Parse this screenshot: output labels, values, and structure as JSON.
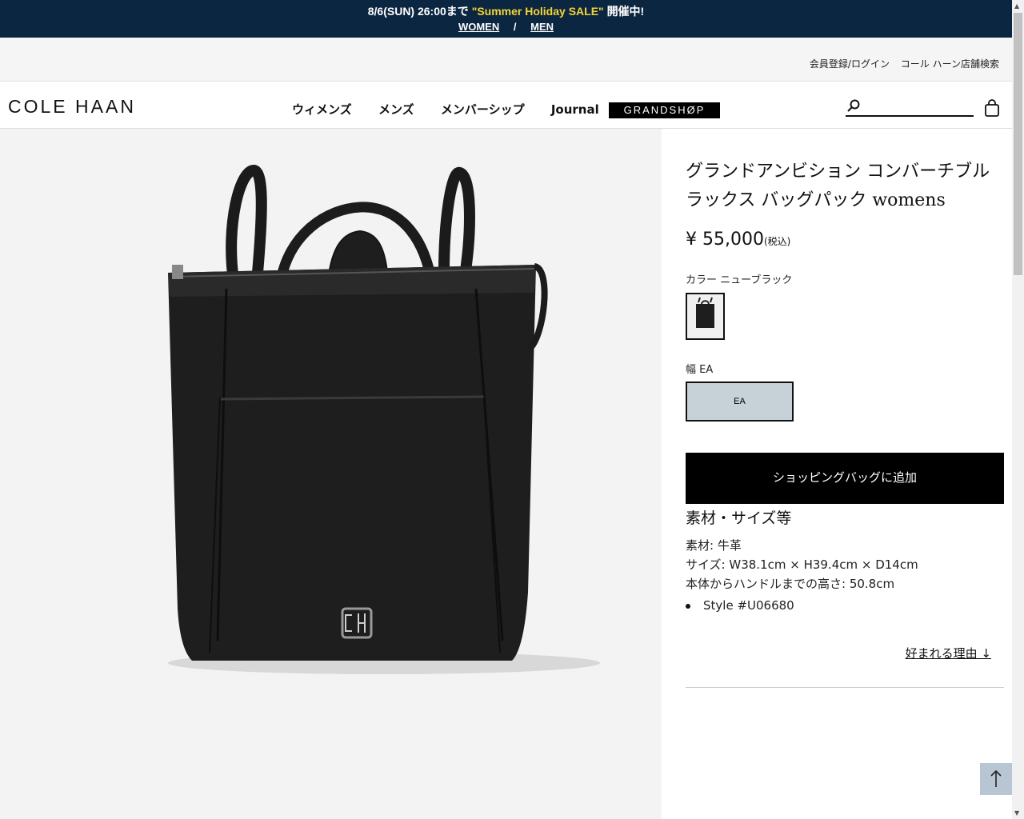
{
  "promo": {
    "line1_prefix": "8/6(SUN) 26:00まで",
    "sale_text": "\"Summer Holiday SALE\"",
    "line1_suffix": "開催中!",
    "women_link": "WOMEN",
    "separator": "/",
    "men_link": "MEN",
    "colors": {
      "background": "#0b2641",
      "sale": "#f4d534"
    }
  },
  "utility": {
    "login": "会員登録/ログイン",
    "store_search": "コール ハーン店舗検索"
  },
  "header": {
    "logo": "COLE HAAN",
    "nav": [
      "ウィメンズ",
      "メンズ",
      "メンバーシップ",
      "Journal"
    ],
    "grandshop": "GRANDSHØP",
    "search_placeholder": "",
    "icons": [
      "search-icon",
      "bag-icon"
    ]
  },
  "product": {
    "title": "グランドアンビション コンバーチブル ラックス バッグパック womens",
    "price": "¥ 55,000",
    "tax_note": "(税込)",
    "color_label": "カラー ニューブラック",
    "width_label": "幅 EA",
    "size_option": "EA",
    "add_to_bag": "ショッピングバッグに追加",
    "spec_heading": "素材・サイズ等",
    "material": "素材: 牛革",
    "size": "サイズ: W38.1cm × H39.4cm × D14cm",
    "handle_height": "本体からハンドルまでの高さ: 50.8cm",
    "style": "Style #U06680",
    "reason_link": "好まれる理由 ↓"
  },
  "to_top": "↑"
}
